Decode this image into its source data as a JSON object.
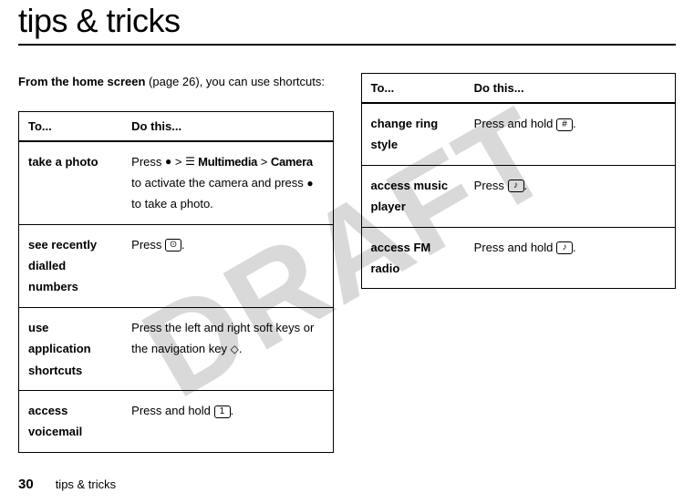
{
  "watermark": "DRAFT",
  "title": "tips & tricks",
  "intro_bold": "From the home screen",
  "intro_rest": " (page 26), you can use shortcuts:",
  "table_headers": {
    "to": "To...",
    "do": "Do this..."
  },
  "left_rows": [
    {
      "to": "take a photo",
      "do_pre": "Press ",
      "icon1": "center-key-icon",
      "mid": " > ",
      "icon2": "multimedia-icon",
      "menu1": " Multimedia",
      "mid2": " > ",
      "menu2": "Camera",
      "do_post1": " to activate the camera and press ",
      "icon3": "center-key-icon",
      "do_post2": " to take a photo."
    },
    {
      "to": "see recently dialled numbers",
      "do_pre": "Press ",
      "icon1": "send-key-icon",
      "do_post": "."
    },
    {
      "to": "use application shortcuts",
      "do_pre": "Press the left and right soft keys or the navigation key ",
      "icon1": "nav-key-icon",
      "do_post": "."
    },
    {
      "to": "access voicemail",
      "do_pre": "Press and hold ",
      "icon1": "key-1-icon",
      "key_label": "1",
      "do_post": "."
    }
  ],
  "right_rows": [
    {
      "to": "change ring style",
      "do_pre": "Press and hold ",
      "icon1": "key-hash-icon",
      "key_label": "#",
      "do_post": "."
    },
    {
      "to": "access music player",
      "do_pre": "Press ",
      "icon1": "music-key-icon",
      "key_label": "♪",
      "do_post": "."
    },
    {
      "to": "access FM radio",
      "do_pre": "Press and hold ",
      "icon1": "music-key-icon",
      "key_label": "♪",
      "do_post": "."
    }
  ],
  "footer": {
    "page": "30",
    "text": "tips & tricks"
  }
}
